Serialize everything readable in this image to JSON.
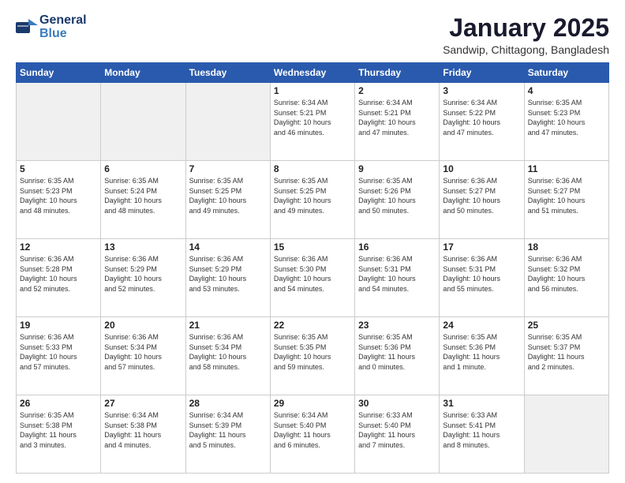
{
  "header": {
    "logo_general": "General",
    "logo_blue": "Blue",
    "month": "January 2025",
    "location": "Sandwip, Chittagong, Bangladesh"
  },
  "weekdays": [
    "Sunday",
    "Monday",
    "Tuesday",
    "Wednesday",
    "Thursday",
    "Friday",
    "Saturday"
  ],
  "weeks": [
    [
      {
        "day": "",
        "info": ""
      },
      {
        "day": "",
        "info": ""
      },
      {
        "day": "",
        "info": ""
      },
      {
        "day": "1",
        "info": "Sunrise: 6:34 AM\nSunset: 5:21 PM\nDaylight: 10 hours\nand 46 minutes."
      },
      {
        "day": "2",
        "info": "Sunrise: 6:34 AM\nSunset: 5:21 PM\nDaylight: 10 hours\nand 47 minutes."
      },
      {
        "day": "3",
        "info": "Sunrise: 6:34 AM\nSunset: 5:22 PM\nDaylight: 10 hours\nand 47 minutes."
      },
      {
        "day": "4",
        "info": "Sunrise: 6:35 AM\nSunset: 5:23 PM\nDaylight: 10 hours\nand 47 minutes."
      }
    ],
    [
      {
        "day": "5",
        "info": "Sunrise: 6:35 AM\nSunset: 5:23 PM\nDaylight: 10 hours\nand 48 minutes."
      },
      {
        "day": "6",
        "info": "Sunrise: 6:35 AM\nSunset: 5:24 PM\nDaylight: 10 hours\nand 48 minutes."
      },
      {
        "day": "7",
        "info": "Sunrise: 6:35 AM\nSunset: 5:25 PM\nDaylight: 10 hours\nand 49 minutes."
      },
      {
        "day": "8",
        "info": "Sunrise: 6:35 AM\nSunset: 5:25 PM\nDaylight: 10 hours\nand 49 minutes."
      },
      {
        "day": "9",
        "info": "Sunrise: 6:35 AM\nSunset: 5:26 PM\nDaylight: 10 hours\nand 50 minutes."
      },
      {
        "day": "10",
        "info": "Sunrise: 6:36 AM\nSunset: 5:27 PM\nDaylight: 10 hours\nand 50 minutes."
      },
      {
        "day": "11",
        "info": "Sunrise: 6:36 AM\nSunset: 5:27 PM\nDaylight: 10 hours\nand 51 minutes."
      }
    ],
    [
      {
        "day": "12",
        "info": "Sunrise: 6:36 AM\nSunset: 5:28 PM\nDaylight: 10 hours\nand 52 minutes."
      },
      {
        "day": "13",
        "info": "Sunrise: 6:36 AM\nSunset: 5:29 PM\nDaylight: 10 hours\nand 52 minutes."
      },
      {
        "day": "14",
        "info": "Sunrise: 6:36 AM\nSunset: 5:29 PM\nDaylight: 10 hours\nand 53 minutes."
      },
      {
        "day": "15",
        "info": "Sunrise: 6:36 AM\nSunset: 5:30 PM\nDaylight: 10 hours\nand 54 minutes."
      },
      {
        "day": "16",
        "info": "Sunrise: 6:36 AM\nSunset: 5:31 PM\nDaylight: 10 hours\nand 54 minutes."
      },
      {
        "day": "17",
        "info": "Sunrise: 6:36 AM\nSunset: 5:31 PM\nDaylight: 10 hours\nand 55 minutes."
      },
      {
        "day": "18",
        "info": "Sunrise: 6:36 AM\nSunset: 5:32 PM\nDaylight: 10 hours\nand 56 minutes."
      }
    ],
    [
      {
        "day": "19",
        "info": "Sunrise: 6:36 AM\nSunset: 5:33 PM\nDaylight: 10 hours\nand 57 minutes."
      },
      {
        "day": "20",
        "info": "Sunrise: 6:36 AM\nSunset: 5:34 PM\nDaylight: 10 hours\nand 57 minutes."
      },
      {
        "day": "21",
        "info": "Sunrise: 6:36 AM\nSunset: 5:34 PM\nDaylight: 10 hours\nand 58 minutes."
      },
      {
        "day": "22",
        "info": "Sunrise: 6:35 AM\nSunset: 5:35 PM\nDaylight: 10 hours\nand 59 minutes."
      },
      {
        "day": "23",
        "info": "Sunrise: 6:35 AM\nSunset: 5:36 PM\nDaylight: 11 hours\nand 0 minutes."
      },
      {
        "day": "24",
        "info": "Sunrise: 6:35 AM\nSunset: 5:36 PM\nDaylight: 11 hours\nand 1 minute."
      },
      {
        "day": "25",
        "info": "Sunrise: 6:35 AM\nSunset: 5:37 PM\nDaylight: 11 hours\nand 2 minutes."
      }
    ],
    [
      {
        "day": "26",
        "info": "Sunrise: 6:35 AM\nSunset: 5:38 PM\nDaylight: 11 hours\nand 3 minutes."
      },
      {
        "day": "27",
        "info": "Sunrise: 6:34 AM\nSunset: 5:38 PM\nDaylight: 11 hours\nand 4 minutes."
      },
      {
        "day": "28",
        "info": "Sunrise: 6:34 AM\nSunset: 5:39 PM\nDaylight: 11 hours\nand 5 minutes."
      },
      {
        "day": "29",
        "info": "Sunrise: 6:34 AM\nSunset: 5:40 PM\nDaylight: 11 hours\nand 6 minutes."
      },
      {
        "day": "30",
        "info": "Sunrise: 6:33 AM\nSunset: 5:40 PM\nDaylight: 11 hours\nand 7 minutes."
      },
      {
        "day": "31",
        "info": "Sunrise: 6:33 AM\nSunset: 5:41 PM\nDaylight: 11 hours\nand 8 minutes."
      },
      {
        "day": "",
        "info": ""
      }
    ]
  ]
}
